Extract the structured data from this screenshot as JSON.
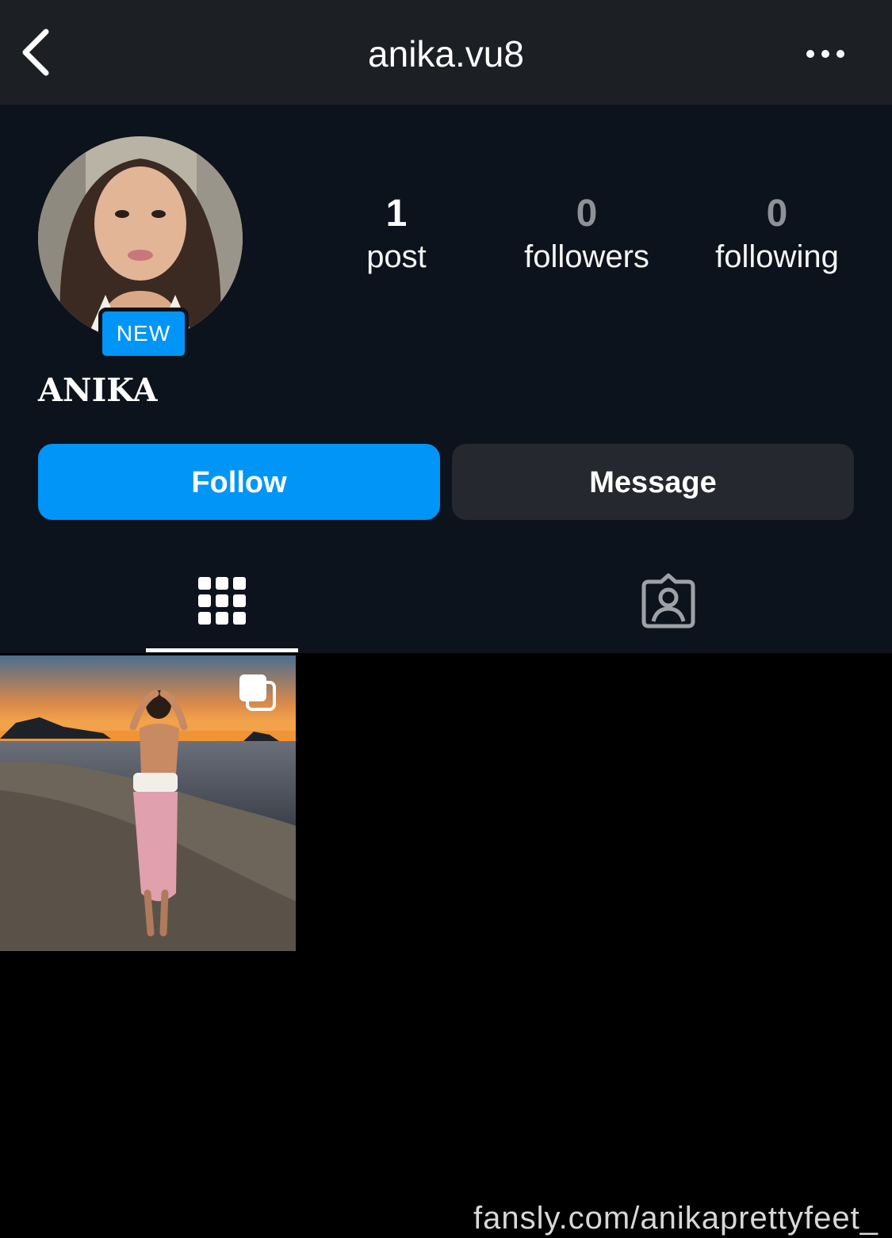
{
  "header": {
    "username": "anika.vu8",
    "back_icon": "chevron-left-icon",
    "more_icon": "ellipsis-horizontal-icon"
  },
  "profile": {
    "display_name": "ANIKA",
    "badge": "NEW",
    "stats": {
      "posts": {
        "value": "1",
        "label": "post"
      },
      "followers": {
        "value": "0",
        "label": "followers"
      },
      "following": {
        "value": "0",
        "label": "following"
      }
    }
  },
  "actions": {
    "follow_label": "Follow",
    "message_label": "Message"
  },
  "tabs": [
    {
      "icon": "grid-icon",
      "active": true
    },
    {
      "icon": "tagged-person-icon",
      "active": false
    }
  ],
  "posts": [
    {
      "kind": "carousel",
      "icon": "multiple-photos-icon"
    }
  ],
  "watermark": "fansly.com/anikaprettyfeet_",
  "colors": {
    "accent": "#0095f6",
    "topbar": "#1c1f24",
    "profile_bg": "#0d131c",
    "secondary_button": "#25282e",
    "page_bg": "#000000"
  }
}
